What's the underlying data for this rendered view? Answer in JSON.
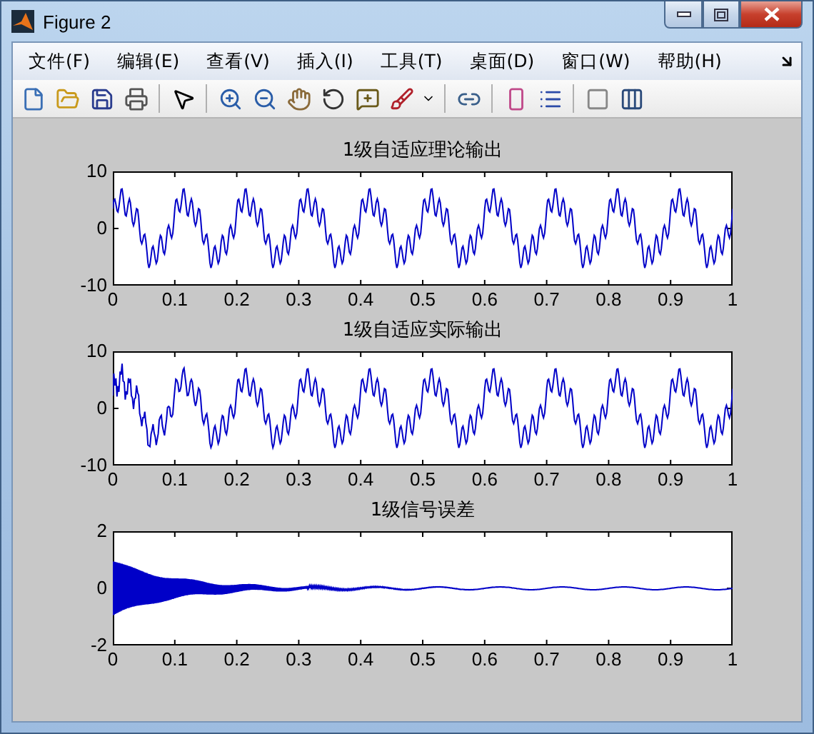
{
  "window": {
    "title": "Figure 2"
  },
  "menu": [
    {
      "label": "文件(F)"
    },
    {
      "label": "编辑(E)"
    },
    {
      "label": "查看(V)"
    },
    {
      "label": "插入(I)"
    },
    {
      "label": "工具(T)"
    },
    {
      "label": "桌面(D)"
    },
    {
      "label": "窗口(W)"
    },
    {
      "label": "帮助(H)"
    }
  ],
  "plots": [
    {
      "kind": "clean",
      "title": "1级自适应理论输出",
      "yticks": [
        "10",
        "0",
        "-10"
      ],
      "xticks": [
        "0",
        "0.1",
        "0.2",
        "0.3",
        "0.4",
        "0.5",
        "0.6",
        "0.7",
        "0.8",
        "0.9",
        "1"
      ]
    },
    {
      "kind": "adapted",
      "title": "1级自适应实际输出",
      "yticks": [
        "10",
        "0",
        "-10"
      ],
      "xticks": [
        "0",
        "0.1",
        "0.2",
        "0.3",
        "0.4",
        "0.5",
        "0.6",
        "0.7",
        "0.8",
        "0.9",
        "1"
      ]
    },
    {
      "kind": "error",
      "title": "1级信号误差",
      "yticks": [
        "2",
        "0",
        "-2"
      ],
      "xticks": [
        "0",
        "0.1",
        "0.2",
        "0.3",
        "0.4",
        "0.5",
        "0.6",
        "0.7",
        "0.8",
        "0.9",
        "1"
      ]
    }
  ]
}
